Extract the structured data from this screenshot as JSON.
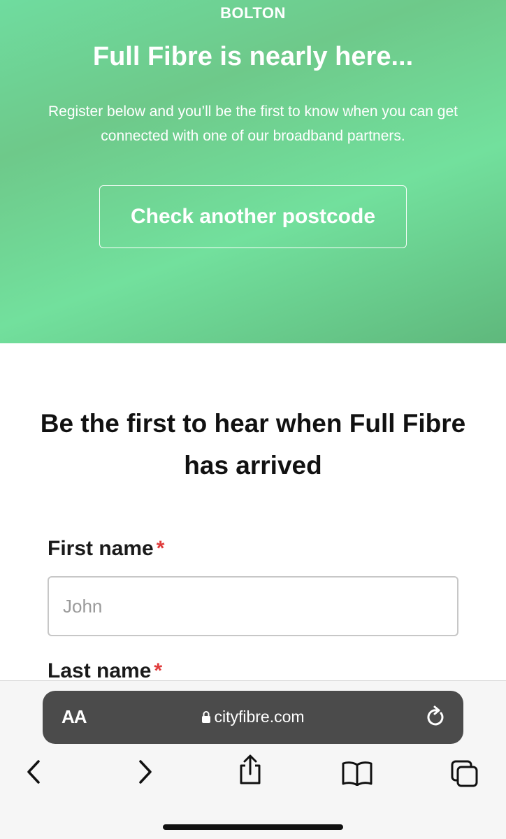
{
  "hero": {
    "location": "BOLTON",
    "title": "Full Fibre is nearly here...",
    "subtitle": "Register below and you’ll be the first to know when you can get connected with one of our broadband partners.",
    "button_label": "Check another postcode"
  },
  "form": {
    "heading": "Be the first to hear when Full Fibre has arrived",
    "first_name": {
      "label": "First name",
      "required_mark": "*",
      "placeholder": "John",
      "value": ""
    },
    "last_name": {
      "label": "Last name",
      "required_mark": "*"
    }
  },
  "browser": {
    "text_size_label": "AA",
    "url": "cityfibre.com",
    "icons": [
      "lock-icon",
      "reload-icon",
      "back-icon",
      "forward-icon",
      "share-icon",
      "bookmarks-icon",
      "tabs-icon"
    ]
  },
  "colors": {
    "hero_green": "#6fdc9f",
    "required_red": "#e03b3b",
    "url_bar_bg": "#4b4b4b"
  }
}
